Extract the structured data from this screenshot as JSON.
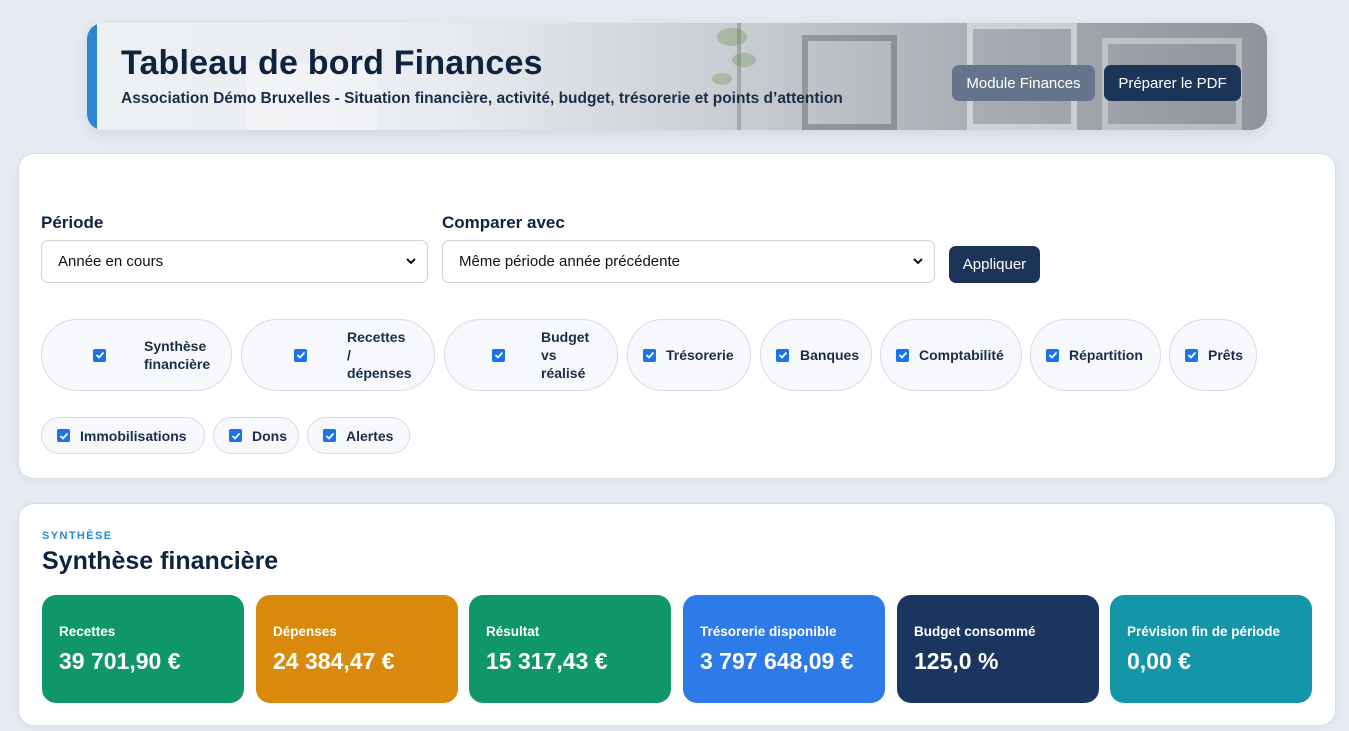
{
  "header": {
    "title": "Tableau de bord Finances",
    "subtitle": "Association Démo Bruxelles - Situation financière, activité, budget, trésorerie et points d’attention",
    "module_button": "Module Finances",
    "pdf_button": "Préparer le PDF"
  },
  "filters": {
    "period_label": "Période",
    "period_value": "Année en cours",
    "compare_label": "Comparer avec",
    "compare_value": "Même période année précédente",
    "apply_button": "Appliquer",
    "sections": [
      {
        "line1": "Synthèse",
        "line2": "financière",
        "line3": "",
        "checked": true
      },
      {
        "line1": "Recettes",
        "line2": "/",
        "line3": "dépenses",
        "checked": true
      },
      {
        "line1": "Budget",
        "line2": "vs",
        "line3": "réalisé",
        "checked": true
      },
      {
        "line1": "Trésorerie",
        "checked": true
      },
      {
        "line1": "Banques",
        "checked": true
      },
      {
        "line1": "Comptabilité",
        "checked": true
      },
      {
        "line1": "Répartition",
        "checked": true
      },
      {
        "line1": "Prêts",
        "checked": true
      },
      {
        "line1": "Immobilisations",
        "checked": true
      },
      {
        "line1": "Dons",
        "checked": true
      },
      {
        "line1": "Alertes",
        "checked": true
      }
    ]
  },
  "synthesis": {
    "kicker": "SYNTHÈSE",
    "title": "Synthèse financière",
    "kpis": [
      {
        "label": "Recettes",
        "value": "39 701,90 €",
        "color": "#109769"
      },
      {
        "label": "Dépenses",
        "value": "24 384,47 €",
        "color": "#d98a0d"
      },
      {
        "label": "Résultat",
        "value": "15 317,43 €",
        "color": "#109769"
      },
      {
        "label": "Trésorerie disponible",
        "value": "3 797 648,09 €",
        "color": "#2c7be8"
      },
      {
        "label": "Budget consommé",
        "value": "125,0 %",
        "color": "#1a3560"
      },
      {
        "label": "Prévision fin de période",
        "value": "0,00 €",
        "color": "#1496a8"
      }
    ]
  },
  "colors": {
    "accent": "#2b86d6",
    "navy": "#1c3458",
    "slate": "#66748b",
    "checkbox": "#1a73e8"
  }
}
